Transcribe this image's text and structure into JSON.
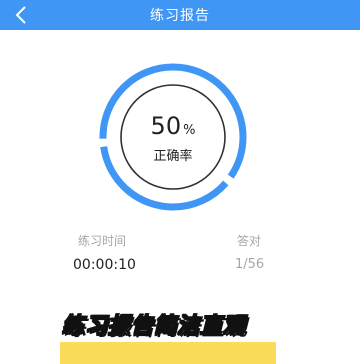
{
  "header": {
    "back_icon": "chevron-left-icon",
    "title": "练习报告"
  },
  "result": {
    "accuracy_value": "50",
    "accuracy_unit": "%",
    "accuracy_fraction": 0.5,
    "accuracy_label": "正确率"
  },
  "stats": {
    "time_label": "练习时间",
    "time_value": "00:00:10",
    "answered_label": "答对",
    "answered_value": "1/56"
  },
  "banner": {
    "caption": "练习报告简洁直观"
  },
  "colors": {
    "header_bg": "#3f96f4",
    "ring_accent": "#3f96f4",
    "banner_highlight": "#fbdb5a"
  }
}
